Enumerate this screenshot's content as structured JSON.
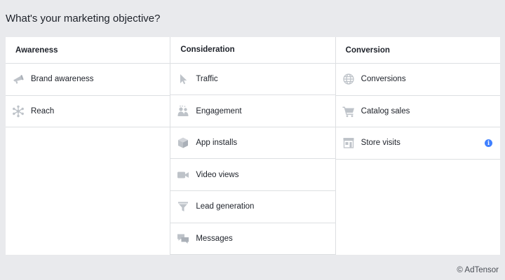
{
  "title": "What's your marketing objective?",
  "columns": [
    {
      "header": "Awareness",
      "items": [
        {
          "label": "Brand awareness",
          "icon": "megaphone-icon"
        },
        {
          "label": "Reach",
          "icon": "reach-icon"
        }
      ]
    },
    {
      "header": "Consideration",
      "items": [
        {
          "label": "Traffic",
          "icon": "cursor-icon"
        },
        {
          "label": "Engagement",
          "icon": "people-icon"
        },
        {
          "label": "App installs",
          "icon": "box-icon"
        },
        {
          "label": "Video views",
          "icon": "video-camera-icon"
        },
        {
          "label": "Lead generation",
          "icon": "funnel-icon"
        },
        {
          "label": "Messages",
          "icon": "chat-bubbles-icon"
        }
      ]
    },
    {
      "header": "Conversion",
      "items": [
        {
          "label": "Conversions",
          "icon": "globe-icon"
        },
        {
          "label": "Catalog sales",
          "icon": "shopping-cart-icon"
        },
        {
          "label": "Store visits",
          "icon": "store-icon",
          "info": "i"
        }
      ]
    }
  ],
  "copyright": "© AdTensor",
  "colors": {
    "background": "#e9eaed",
    "panel": "#ffffff",
    "divider": "#dddfe2",
    "icon": "#bec3c9",
    "info": "#4080ff"
  }
}
